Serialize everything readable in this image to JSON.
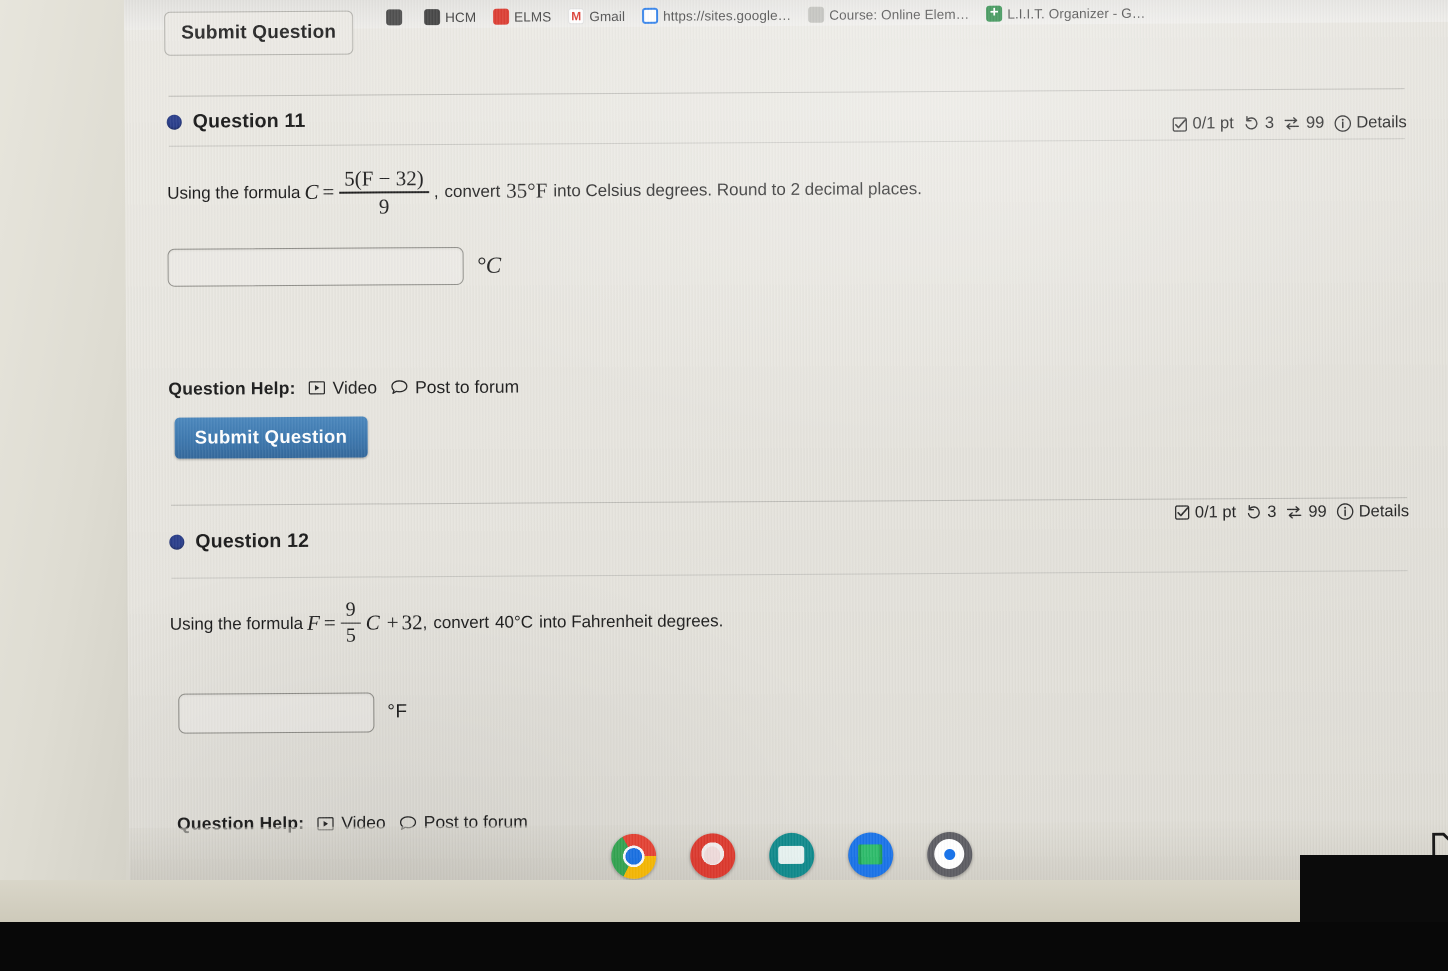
{
  "browser": {
    "bookmarks": [
      {
        "label": "",
        "icon": "circle-dark-favicon"
      },
      {
        "label": "HCM",
        "icon": "circle-dark-favicon"
      },
      {
        "label": "ELMS",
        "icon": "red-square-favicon"
      },
      {
        "label": "Gmail",
        "icon": "gmail-favicon"
      },
      {
        "label": "https://sites.google…",
        "icon": "google-sites-favicon"
      },
      {
        "label": "Course: Online Elem…",
        "icon": "grey-book-favicon"
      },
      {
        "label": "L.I.I.T. Organizer - G…",
        "icon": "green-sheets-favicon"
      }
    ]
  },
  "clipped_top": {
    "submit_label": "Submit Question"
  },
  "questions": [
    {
      "title": "Question 11",
      "meta": {
        "points": "0/1 pt",
        "attempts": "3",
        "versions": "99",
        "details_label": "Details",
        "checkbox_icon": "checkbox-checked-icon",
        "retry_icon": "undo-arrow-icon",
        "swap_icon": "swap-arrows-icon",
        "info_icon": "info-circle-icon"
      },
      "prompt": {
        "lead": "Using the formula",
        "var_left": "C",
        "equals": "=",
        "fraction_num": "5(F − 32)",
        "fraction_den": "9",
        "comma": ",",
        "mid": "convert",
        "value": "35°F",
        "tail": "into Celsius degrees. Round to 2 decimal places."
      },
      "answer": {
        "value": "",
        "placeholder": "",
        "unit": "°C"
      },
      "help": {
        "label": "Question Help:",
        "video_label": "Video",
        "video_icon": "video-play-icon",
        "forum_label": "Post to forum",
        "forum_icon": "speech-bubble-icon"
      },
      "submit_label": "Submit Question"
    },
    {
      "title": "Question 12",
      "meta": {
        "points": "0/1 pt",
        "attempts": "3",
        "versions": "99",
        "details_label": "Details",
        "checkbox_icon": "checkbox-checked-icon",
        "retry_icon": "undo-arrow-icon",
        "swap_icon": "swap-arrows-icon",
        "info_icon": "info-circle-icon"
      },
      "prompt": {
        "lead": "Using the formula",
        "var_left": "F",
        "equals": "=",
        "fraction_num": "9",
        "fraction_den": "5",
        "var_right": "C",
        "plus": "+",
        "const": "32",
        "comma": ",",
        "mid": "convert",
        "value": "40°C",
        "tail": "into Fahrenheit degrees."
      },
      "answer": {
        "value": "",
        "placeholder": "",
        "unit": "°F"
      },
      "help": {
        "label": "Question Help:",
        "video_label": "Video",
        "video_icon": "video-play-icon",
        "forum_label": "Post to forum",
        "forum_icon": "speech-bubble-icon"
      }
    }
  ],
  "shelf": {
    "icons": [
      {
        "name": "chrome-icon",
        "label": "Chrome"
      },
      {
        "name": "red-app-icon",
        "label": ""
      },
      {
        "name": "teal-app-icon",
        "label": ""
      },
      {
        "name": "blue-app-icon",
        "label": ""
      },
      {
        "name": "settings-gear-icon",
        "label": ""
      }
    ]
  },
  "colors": {
    "accent_blue": "#3b76ad",
    "bullet_navy": "#2b3f8c",
    "page_bg": "#e9e8e3",
    "text": "#1c1c1c"
  }
}
